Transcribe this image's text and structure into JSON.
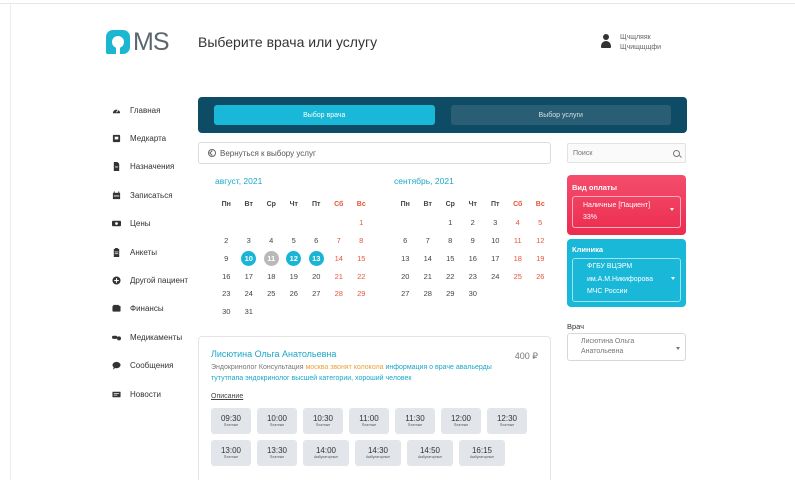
{
  "header": {
    "logo_text": "MS",
    "title": "Выберите врача или услугу",
    "user_line1": "Щчщляяк",
    "user_line2": "Щчищщщфи"
  },
  "sidebar": {
    "items": [
      {
        "label": "Главная",
        "icon": "dashboard-icon"
      },
      {
        "label": "Медкарта",
        "icon": "medcard-icon"
      },
      {
        "label": "Назначения",
        "icon": "document-icon"
      },
      {
        "label": "Записаться",
        "icon": "calendar-icon"
      },
      {
        "label": "Цены",
        "icon": "money-icon"
      },
      {
        "label": "Анкеты",
        "icon": "clipboard-icon"
      },
      {
        "label": "Другой пациент",
        "icon": "add-user-icon"
      },
      {
        "label": "Финансы",
        "icon": "wallet-icon"
      },
      {
        "label": "Медикаменты",
        "icon": "pills-icon"
      },
      {
        "label": "Сообщения",
        "icon": "chat-icon"
      },
      {
        "label": "Новости",
        "icon": "news-icon"
      }
    ]
  },
  "tabs": {
    "doctor": "Выбор врача",
    "service": "Выбор услуги"
  },
  "back": {
    "label": "Вернуться к выбору услуг"
  },
  "search": {
    "placeholder": "Поиск"
  },
  "weekdays": [
    "Пн",
    "Вт",
    "Ср",
    "Чт",
    "Пт",
    "Сб",
    "Вс"
  ],
  "calendars": [
    {
      "title": "август, 2021",
      "weeks": [
        [
          "",
          "",
          "",
          "",
          "",
          "",
          "1"
        ],
        [
          "2",
          "3",
          "4",
          "5",
          "6",
          "7",
          "8"
        ],
        [
          "9",
          "10",
          "11",
          "12",
          "13",
          "14",
          "15"
        ],
        [
          "16",
          "17",
          "18",
          "19",
          "20",
          "21",
          "22"
        ],
        [
          "23",
          "24",
          "25",
          "26",
          "27",
          "28",
          "29"
        ],
        [
          "30",
          "31",
          "",
          "",
          "",
          "",
          ""
        ]
      ],
      "selected": [
        "10",
        "12",
        "13"
      ],
      "grayed": [
        "11"
      ]
    },
    {
      "title": "сентябрь, 2021",
      "weeks": [
        [
          "",
          "",
          "1",
          "2",
          "3",
          "4",
          "5"
        ],
        [
          "6",
          "7",
          "8",
          "9",
          "10",
          "11",
          "12"
        ],
        [
          "13",
          "14",
          "15",
          "16",
          "17",
          "18",
          "19"
        ],
        [
          "20",
          "21",
          "22",
          "23",
          "24",
          "25",
          "26"
        ],
        [
          "27",
          "28",
          "29",
          "30",
          "",
          "",
          ""
        ]
      ],
      "selected": [],
      "grayed": []
    }
  ],
  "payment": {
    "label": "Вид оплаты",
    "value_line1": "Наличные [Пациент]",
    "value_line2": "33%"
  },
  "clinic": {
    "label": "Клиника",
    "value_line1": "ФГБУ ВЦЭРМ",
    "value_line2": "им.А.М.Никифорова",
    "value_line3": "МЧС России"
  },
  "doctor_select": {
    "label": "Врач",
    "value_line1": "Лисютина Ольга",
    "value_line2": "Анатольевна"
  },
  "doctor_card": {
    "name": "Лисютина Ольга Анатольевна",
    "price": "400 ₽",
    "desc_part1": "Эндокринолог Консультация ",
    "desc_part2": "москва звонят колокола ",
    "desc_part3": "информация о враче авальерды тутутпапа",
    "desc_part4": " эндокринолог высшей категории, хороший человек",
    "link": "Описание",
    "slots": [
      {
        "time": "09:30",
        "type": "Платные"
      },
      {
        "time": "10:00",
        "type": "Платные"
      },
      {
        "time": "10:30",
        "type": "Платные"
      },
      {
        "time": "11:00",
        "type": "Платные"
      },
      {
        "time": "11:30",
        "type": "Платные"
      },
      {
        "time": "12:00",
        "type": "Платные"
      },
      {
        "time": "12:30",
        "type": "Платные"
      },
      {
        "time": "13:00",
        "type": "Платные"
      },
      {
        "time": "13:30",
        "type": "Платные"
      },
      {
        "time": "14:00",
        "type": "Амбулаторные"
      },
      {
        "time": "14:30",
        "type": "Амбулаторные"
      },
      {
        "time": "14:50",
        "type": "Амбулаторные"
      },
      {
        "time": "16:15",
        "type": "Амбулаторные"
      }
    ]
  },
  "colors": {
    "accent": "#19b7d8",
    "tabs_bg": "#0d4c64",
    "payment_card": "#ef3a5c",
    "weekend": "#e8553a"
  }
}
